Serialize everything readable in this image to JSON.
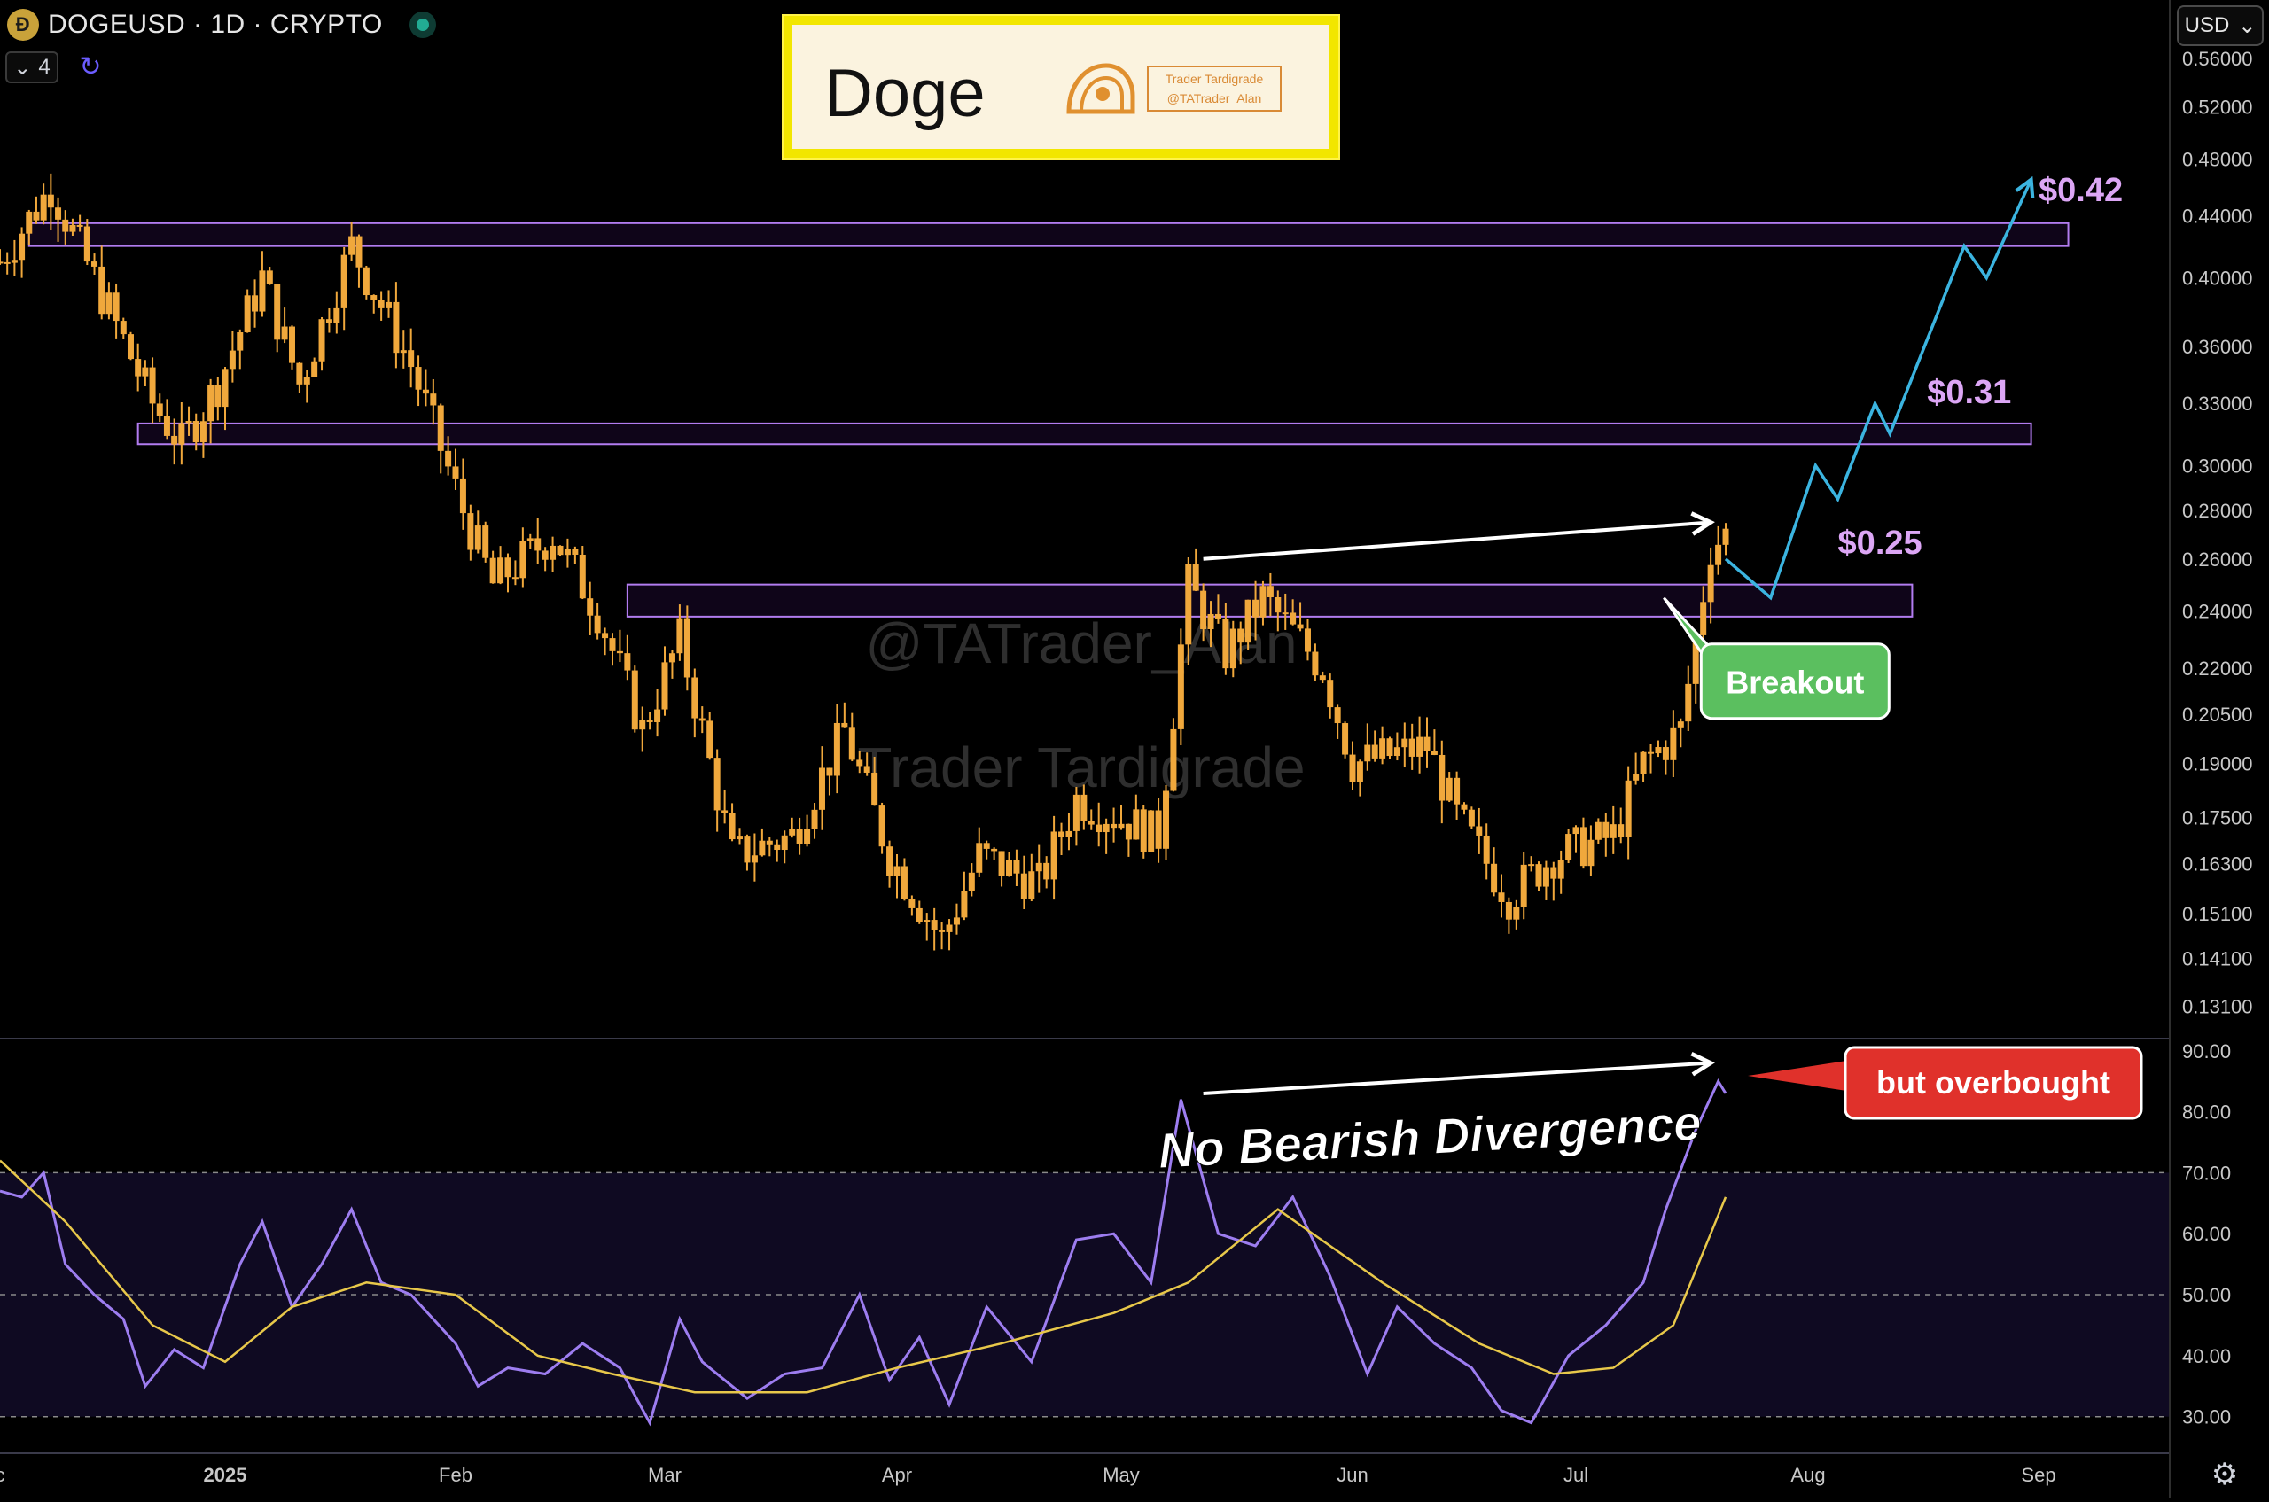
{
  "header": {
    "symbol_text": "DOGEUSD · 1D · CRYPTO",
    "coin_glyph": "Ð",
    "indicator_count": "4"
  },
  "currency": {
    "label": "USD"
  },
  "title_box": {
    "title": "Doge",
    "brand_line1": "Trader Tardigrade",
    "brand_line2": "@TATrader_Alan"
  },
  "watermark": {
    "line1": "@TATrader_Alan",
    "line2": "Trader Tardigrade"
  },
  "colors": {
    "background": "#000000",
    "candle": "#f0a83c",
    "zone_border": "#b27cf0",
    "zone_fill": "#1c0a2e",
    "projection": "#3bb4e0",
    "rsi_line": "#9d7df0",
    "rsi_ma": "#e8c84a",
    "rsi_band": "#0f0a22",
    "breakout": "#5bbf5f",
    "overbought": "#e0312b",
    "level_label": "#dca6f5"
  },
  "icons": {
    "coin": "dogecoin-icon",
    "indicator_toggle": "chevron-down-icon",
    "refresh": "refresh-icon",
    "currency_chevron": "chevron-down-icon",
    "settings": "gear-icon"
  },
  "chart_data": [
    {
      "type": "candlestick",
      "symbol": "DOGEUSD",
      "interval": "1D",
      "y_scale": "log",
      "ylim": [
        0.125,
        0.58
      ],
      "y_ticks": [
        "0.56000",
        "0.52000",
        "0.48000",
        "0.44000",
        "0.40000",
        "0.36000",
        "0.33000",
        "0.30000",
        "0.28000",
        "0.26000",
        "0.24000",
        "0.22000",
        "0.20500",
        "0.19000",
        "0.17500",
        "0.16300",
        "0.15100",
        "0.14100",
        "0.13100"
      ],
      "y_tick_values": [
        0.56,
        0.52,
        0.48,
        0.44,
        0.4,
        0.36,
        0.33,
        0.3,
        0.28,
        0.26,
        0.24,
        0.22,
        0.205,
        0.19,
        0.175,
        0.163,
        0.151,
        0.141,
        0.131
      ],
      "x_ticks": [
        "c",
        "2025",
        "Feb",
        "Mar",
        "Apr",
        "May",
        "Jun",
        "Jul",
        "Aug",
        "Sep"
      ],
      "x_tick_dates": [
        "2024-12-01",
        "2025-01-01",
        "2025-02-01",
        "2025-03-01",
        "2025-04-01",
        "2025-05-01",
        "2025-06-01",
        "2025-07-01",
        "2025-08-01",
        "2025-09-01"
      ],
      "price_path": [
        [
          "2024-12-01",
          0.41
        ],
        [
          "2024-12-08",
          0.46
        ],
        [
          "2024-12-15",
          0.39
        ],
        [
          "2024-12-22",
          0.33
        ],
        [
          "2024-12-26",
          0.31
        ],
        [
          "2024-12-31",
          0.34
        ],
        [
          "2025-01-06",
          0.4
        ],
        [
          "2025-01-11",
          0.34
        ],
        [
          "2025-01-18",
          0.42
        ],
        [
          "2025-01-26",
          0.35
        ],
        [
          "2025-02-02",
          0.28
        ],
        [
          "2025-02-06",
          0.25
        ],
        [
          "2025-02-14",
          0.27
        ],
        [
          "2025-02-20",
          0.24
        ],
        [
          "2025-02-26",
          0.2
        ],
        [
          "2025-03-03",
          0.23
        ],
        [
          "2025-03-10",
          0.165
        ],
        [
          "2025-03-18",
          0.17
        ],
        [
          "2025-03-25",
          0.2
        ],
        [
          "2025-03-31",
          0.165
        ],
        [
          "2025-04-07",
          0.145
        ],
        [
          "2025-04-12",
          0.165
        ],
        [
          "2025-04-20",
          0.158
        ],
        [
          "2025-04-25",
          0.18
        ],
        [
          "2025-05-06",
          0.17
        ],
        [
          "2025-05-10",
          0.25
        ],
        [
          "2025-05-15",
          0.225
        ],
        [
          "2025-05-20",
          0.245
        ],
        [
          "2025-05-28",
          0.22
        ],
        [
          "2025-06-01",
          0.19
        ],
        [
          "2025-06-11",
          0.195
        ],
        [
          "2025-06-15",
          0.175
        ],
        [
          "2025-06-22",
          0.155
        ],
        [
          "2025-06-28",
          0.165
        ],
        [
          "2025-07-06",
          0.17
        ],
        [
          "2025-07-10",
          0.19
        ],
        [
          "2025-07-15",
          0.2
        ],
        [
          "2025-07-19",
          0.265
        ],
        [
          "2025-07-21",
          0.27
        ]
      ],
      "zones": [
        {
          "low": 0.42,
          "high": 0.435,
          "from": "2024-12-05",
          "to": "2025-09-05"
        },
        {
          "low": 0.31,
          "high": 0.32,
          "from": "2024-12-20",
          "to": "2025-08-31"
        },
        {
          "low": 0.238,
          "high": 0.25,
          "from": "2025-02-24",
          "to": "2025-08-15"
        }
      ],
      "projection_path": [
        [
          "2025-07-21",
          0.26
        ],
        [
          "2025-07-27",
          0.245
        ],
        [
          "2025-08-02",
          0.3
        ],
        [
          "2025-08-05",
          0.285
        ],
        [
          "2025-08-10",
          0.33
        ],
        [
          "2025-08-12",
          0.315
        ],
        [
          "2025-08-22",
          0.42
        ],
        [
          "2025-08-25",
          0.4
        ],
        [
          "2025-08-31",
          0.465
        ]
      ],
      "trendline": [
        [
          "2025-05-12",
          0.26
        ],
        [
          "2025-07-19",
          0.275
        ]
      ],
      "annotations": [
        {
          "text": "$0.42",
          "date": "2025-09-01",
          "price": 0.45
        },
        {
          "text": "$0.31",
          "date": "2025-08-17",
          "price": 0.33
        },
        {
          "text": "$0.25",
          "date": "2025-08-05",
          "price": 0.262
        },
        {
          "text": "Breakout",
          "date": "2025-07-26",
          "price": 0.215
        }
      ]
    },
    {
      "type": "line",
      "indicator": "RSI",
      "ylim": [
        24,
        92
      ],
      "y_ticks": [
        "90.00",
        "80.00",
        "70.00",
        "60.00",
        "50.00",
        "40.00",
        "30.00"
      ],
      "y_tick_values": [
        90,
        80,
        70,
        60,
        50,
        40,
        30
      ],
      "bands": [
        70,
        50,
        30
      ],
      "series": [
        {
          "key": "rsi",
          "values": [
            [
              "2024-12-01",
              67
            ],
            [
              "2024-12-04",
              66
            ],
            [
              "2024-12-07",
              70
            ],
            [
              "2024-12-10",
              55
            ],
            [
              "2024-12-14",
              50
            ],
            [
              "2024-12-18",
              46
            ],
            [
              "2024-12-21",
              35
            ],
            [
              "2024-12-25",
              41
            ],
            [
              "2024-12-29",
              38
            ],
            [
              "2025-01-03",
              55
            ],
            [
              "2025-01-06",
              62
            ],
            [
              "2025-01-10",
              48
            ],
            [
              "2025-01-14",
              55
            ],
            [
              "2025-01-18",
              64
            ],
            [
              "2025-01-22",
              52
            ],
            [
              "2025-01-26",
              50
            ],
            [
              "2025-02-01",
              42
            ],
            [
              "2025-02-04",
              35
            ],
            [
              "2025-02-08",
              38
            ],
            [
              "2025-02-13",
              37
            ],
            [
              "2025-02-18",
              42
            ],
            [
              "2025-02-23",
              38
            ],
            [
              "2025-02-27",
              29
            ],
            [
              "2025-03-03",
              46
            ],
            [
              "2025-03-06",
              39
            ],
            [
              "2025-03-12",
              33
            ],
            [
              "2025-03-17",
              37
            ],
            [
              "2025-03-22",
              38
            ],
            [
              "2025-03-27",
              50
            ],
            [
              "2025-03-31",
              36
            ],
            [
              "2025-04-04",
              43
            ],
            [
              "2025-04-08",
              32
            ],
            [
              "2025-04-13",
              48
            ],
            [
              "2025-04-19",
              39
            ],
            [
              "2025-04-25",
              59
            ],
            [
              "2025-04-30",
              60
            ],
            [
              "2025-05-05",
              52
            ],
            [
              "2025-05-09",
              82
            ],
            [
              "2025-05-14",
              60
            ],
            [
              "2025-05-19",
              58
            ],
            [
              "2025-05-24",
              66
            ],
            [
              "2025-05-29",
              53
            ],
            [
              "2025-06-03",
              37
            ],
            [
              "2025-06-07",
              48
            ],
            [
              "2025-06-12",
              42
            ],
            [
              "2025-06-17",
              38
            ],
            [
              "2025-06-21",
              31
            ],
            [
              "2025-06-25",
              29
            ],
            [
              "2025-06-30",
              40
            ],
            [
              "2025-07-05",
              45
            ],
            [
              "2025-07-10",
              52
            ],
            [
              "2025-07-13",
              64
            ],
            [
              "2025-07-17",
              77
            ],
            [
              "2025-07-20",
              85
            ],
            [
              "2025-07-21",
              83
            ]
          ]
        },
        {
          "key": "rsi_ma",
          "values": [
            [
              "2024-12-01",
              72
            ],
            [
              "2024-12-10",
              62
            ],
            [
              "2024-12-22",
              45
            ],
            [
              "2025-01-01",
              39
            ],
            [
              "2025-01-10",
              48
            ],
            [
              "2025-01-20",
              52
            ],
            [
              "2025-02-01",
              50
            ],
            [
              "2025-02-12",
              40
            ],
            [
              "2025-02-22",
              37
            ],
            [
              "2025-03-05",
              34
            ],
            [
              "2025-03-20",
              34
            ],
            [
              "2025-04-01",
              38
            ],
            [
              "2025-04-15",
              42
            ],
            [
              "2025-04-30",
              47
            ],
            [
              "2025-05-10",
              52
            ],
            [
              "2025-05-22",
              64
            ],
            [
              "2025-06-05",
              52
            ],
            [
              "2025-06-18",
              42
            ],
            [
              "2025-06-28",
              37
            ],
            [
              "2025-07-06",
              38
            ],
            [
              "2025-07-14",
              45
            ],
            [
              "2025-07-21",
              66
            ]
          ]
        }
      ],
      "trendline": [
        [
          "2025-05-12",
          83
        ],
        [
          "2025-07-19",
          88
        ]
      ],
      "annotations": [
        {
          "text": "No Bearish Divergence"
        },
        {
          "text": "but overbought"
        }
      ]
    }
  ]
}
